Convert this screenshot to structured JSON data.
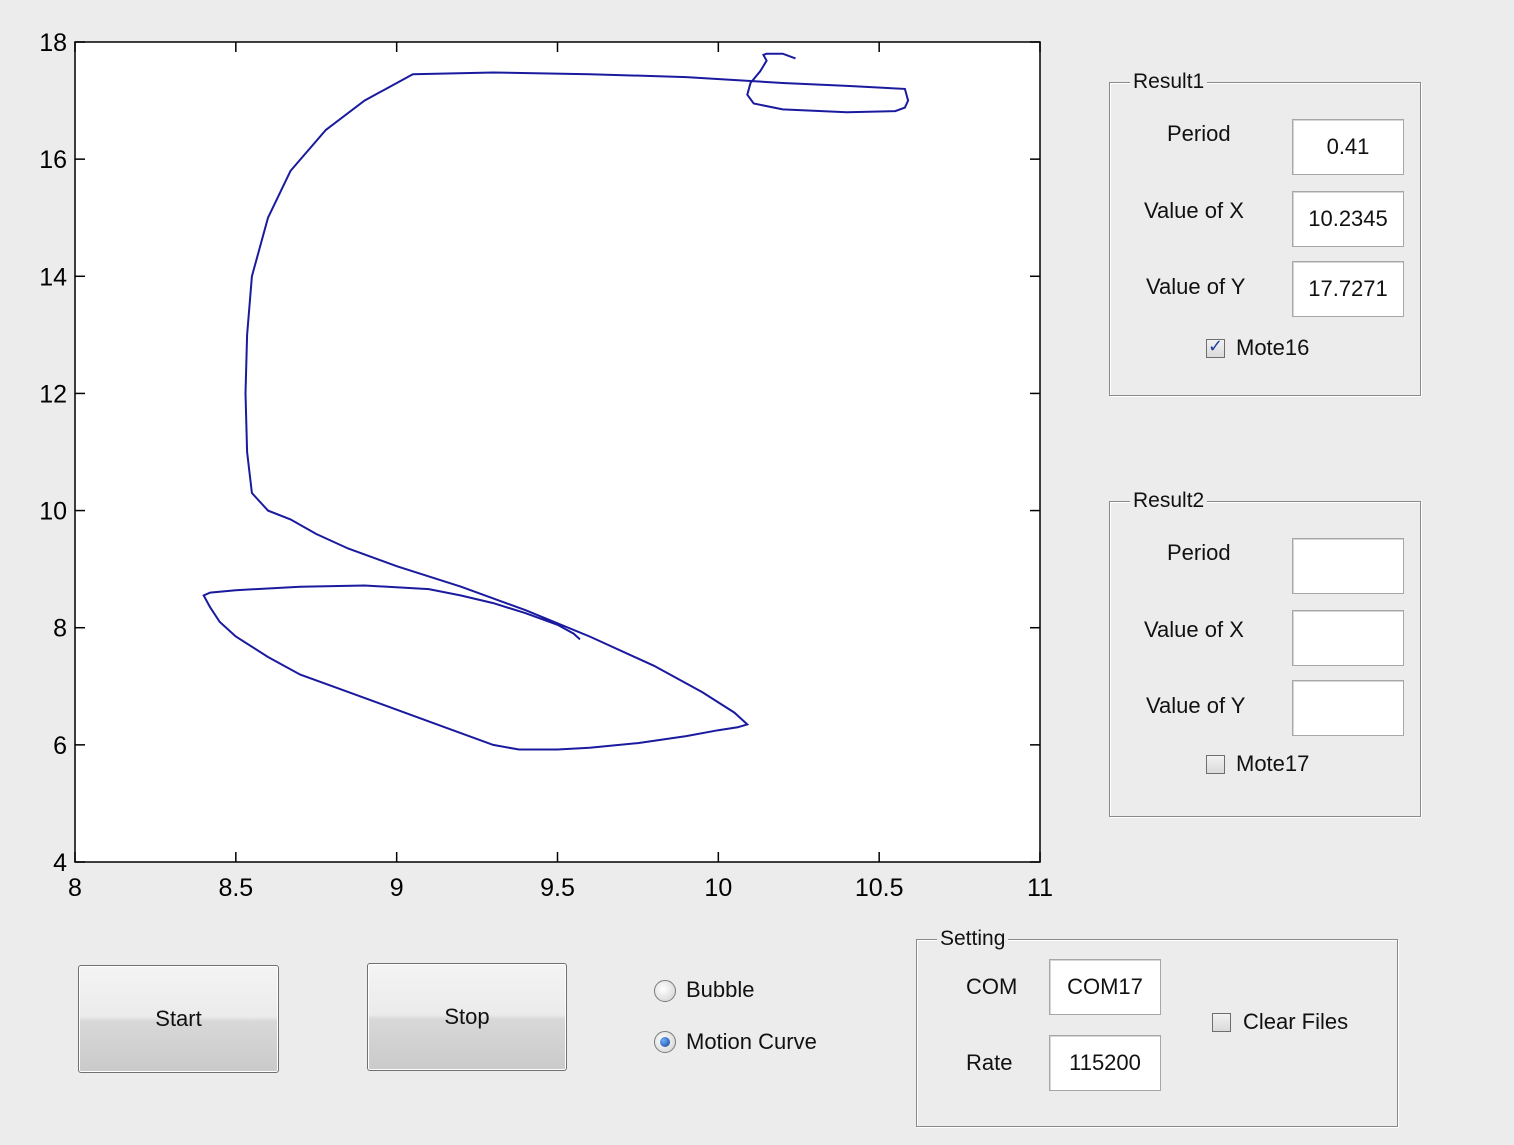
{
  "chart_data": {
    "type": "line",
    "title": "",
    "xlabel": "",
    "ylabel": "",
    "xlim": [
      8,
      11
    ],
    "ylim": [
      4,
      18
    ],
    "x_ticks": [
      "8",
      "8.5",
      "9",
      "9.5",
      "10",
      "10.5",
      "11"
    ],
    "y_ticks": [
      "4",
      "6",
      "8",
      "10",
      "12",
      "14",
      "16",
      "18"
    ],
    "grid": false,
    "series": [
      {
        "color": "#1a1a9e",
        "x": [
          9.57,
          9.55,
          9.5,
          9.4,
          9.3,
          9.2,
          9.1,
          8.9,
          8.7,
          8.5,
          8.42,
          8.4,
          8.42,
          8.45,
          8.5,
          8.6,
          8.7,
          8.85,
          9.0,
          9.15,
          9.3,
          9.38,
          9.5,
          9.6,
          9.75,
          9.9,
          10.0,
          10.06,
          10.09,
          10.05,
          9.95,
          9.8,
          9.6,
          9.4,
          9.2,
          9.0,
          8.85,
          8.75,
          8.67,
          8.6,
          8.55,
          8.535,
          8.53,
          8.535,
          8.55,
          8.6,
          8.67,
          8.78,
          8.9,
          9.05,
          9.3,
          9.6,
          9.9,
          10.2,
          10.4,
          10.58,
          10.59,
          10.58,
          10.55,
          10.4,
          10.2,
          10.11,
          10.09,
          10.1,
          10.13,
          10.15,
          10.14,
          10.15,
          10.2,
          10.24
        ],
        "y": [
          7.8,
          7.9,
          8.05,
          8.25,
          8.42,
          8.55,
          8.66,
          8.72,
          8.7,
          8.64,
          8.6,
          8.55,
          8.35,
          8.1,
          7.85,
          7.5,
          7.2,
          6.9,
          6.6,
          6.3,
          6.0,
          5.92,
          5.92,
          5.95,
          6.03,
          6.15,
          6.25,
          6.3,
          6.35,
          6.55,
          6.9,
          7.35,
          7.85,
          8.3,
          8.7,
          9.05,
          9.35,
          9.6,
          9.85,
          10.0,
          10.3,
          11.0,
          12.0,
          13.0,
          14.0,
          15.0,
          15.8,
          16.5,
          17.0,
          17.45,
          17.48,
          17.45,
          17.4,
          17.3,
          17.25,
          17.2,
          17.0,
          16.88,
          16.82,
          16.8,
          16.85,
          16.95,
          17.1,
          17.3,
          17.5,
          17.68,
          17.78,
          17.8,
          17.8,
          17.72
        ]
      }
    ]
  },
  "result1": {
    "title": "Result1",
    "period_label": "Period",
    "period_value": "0.41",
    "x_label": "Value of X",
    "x_value": "10.2345",
    "y_label": "Value of Y",
    "y_value": "17.7271",
    "mote_label": "Mote16",
    "mote_checked": true
  },
  "result2": {
    "title": "Result2",
    "period_label": "Period",
    "period_value": "",
    "x_label": "Value of X",
    "x_value": "",
    "y_label": "Value of Y",
    "y_value": "",
    "mote_label": "Mote17",
    "mote_checked": false
  },
  "controls": {
    "start_label": "Start",
    "stop_label": "Stop",
    "radio_bubble": "Bubble",
    "radio_motion": "Motion Curve",
    "selected_mode": "Motion Curve"
  },
  "setting": {
    "title": "Setting",
    "com_label": "COM",
    "com_value": "COM17",
    "rate_label": "Rate",
    "rate_value": "115200",
    "clear_label": "Clear Files",
    "clear_checked": false
  }
}
